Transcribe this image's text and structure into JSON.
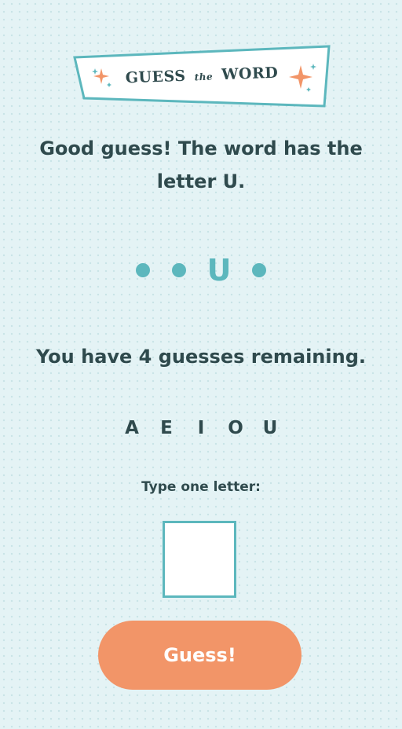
{
  "logo": {
    "word1": "GUESS",
    "word2": "the",
    "word3": "WORD"
  },
  "message": "Good guess! The word has the letter U.",
  "word_slots": [
    "",
    "",
    "U",
    ""
  ],
  "remaining_text": "You have 4 guesses remaining.",
  "guessed_letters": [
    "A",
    "E",
    "I",
    "O",
    "U"
  ],
  "prompt": "Type one letter:",
  "input": {
    "value": "",
    "placeholder": ""
  },
  "button_label": "Guess!",
  "colors": {
    "teal": "#5cb7bd",
    "orange": "#f29568",
    "text": "#2f4a4d",
    "background": "#e4f3f5"
  }
}
